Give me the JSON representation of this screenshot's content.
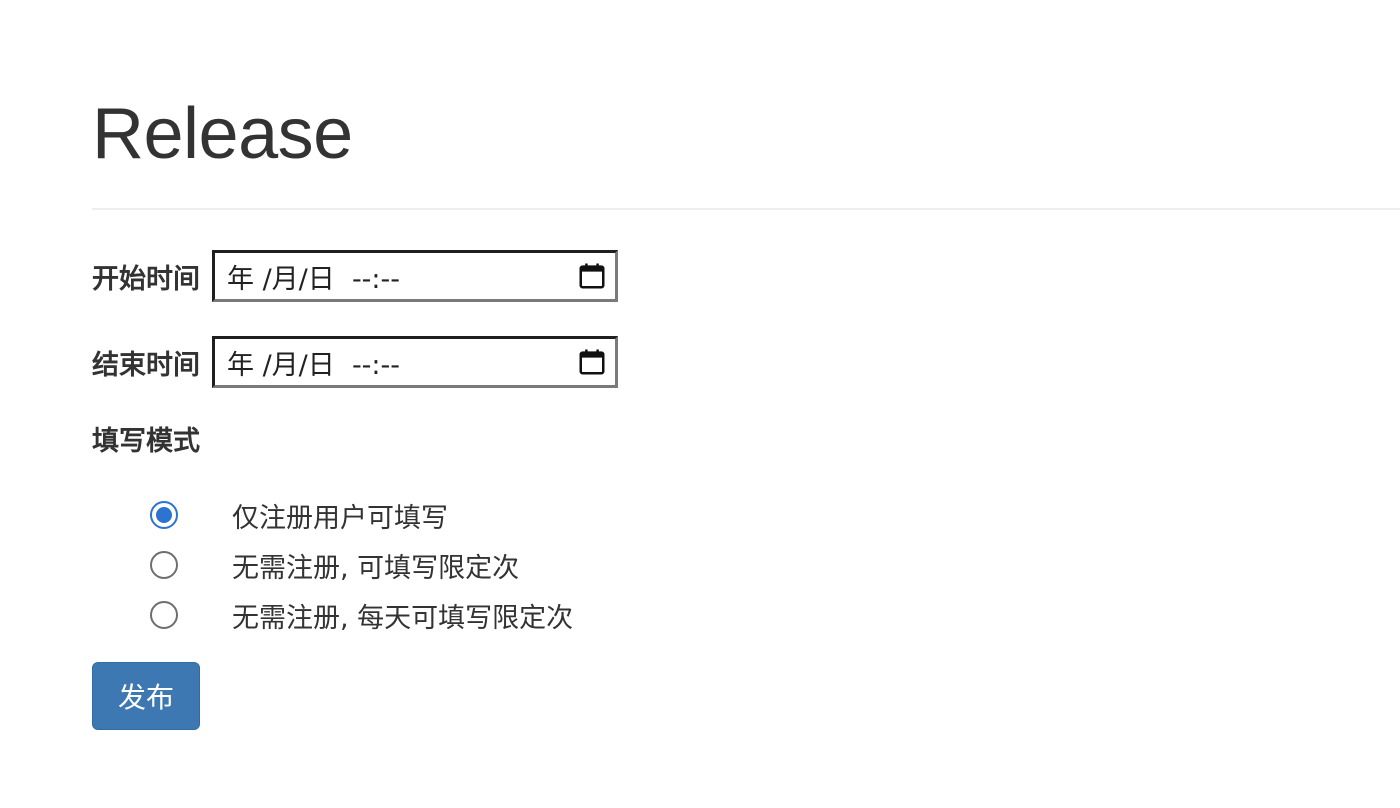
{
  "page": {
    "title": "Release"
  },
  "form": {
    "start": {
      "label": "开始时间",
      "placeholder": "年 /月/日  --:--"
    },
    "end": {
      "label": "结束时间",
      "placeholder": "年 /月/日  --:--"
    },
    "mode": {
      "label": "填写模式",
      "options": [
        {
          "label": "仅注册用户可填写",
          "checked": true
        },
        {
          "label": "无需注册, 可填写限定次",
          "checked": false
        },
        {
          "label": "无需注册, 每天可填写限定次",
          "checked": false
        }
      ]
    },
    "submit_label": "发布"
  },
  "colors": {
    "accent": "#3e78b2",
    "radio_checked": "#2c73d2"
  },
  "icons": {
    "datetime_picker": "calendar-icon"
  }
}
